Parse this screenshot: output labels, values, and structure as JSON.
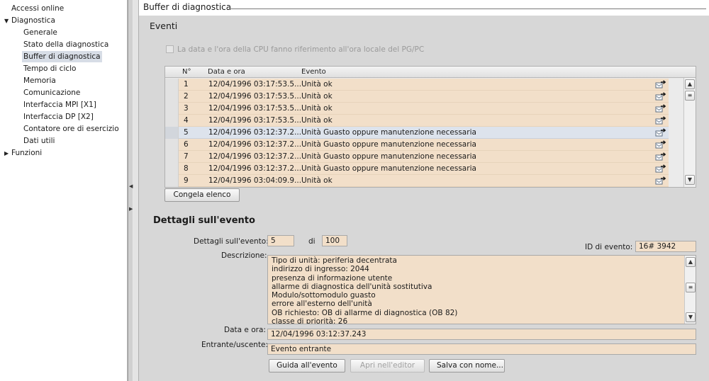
{
  "nav": {
    "items": [
      {
        "label": "Accessi online",
        "level": 0,
        "arrow": ""
      },
      {
        "label": "Diagnostica",
        "level": 0,
        "arrow": "▼"
      },
      {
        "label": "Generale",
        "level": 1,
        "arrow": ""
      },
      {
        "label": "Stato della diagnostica",
        "level": 1,
        "arrow": ""
      },
      {
        "label": "Buffer di diagnostica",
        "level": 1,
        "arrow": "",
        "selected": true
      },
      {
        "label": "Tempo di ciclo",
        "level": 1,
        "arrow": ""
      },
      {
        "label": "Memoria",
        "level": 1,
        "arrow": ""
      },
      {
        "label": "Comunicazione",
        "level": 1,
        "arrow": ""
      },
      {
        "label": "Interfaccia MPI [X1]",
        "level": 1,
        "arrow": ""
      },
      {
        "label": "Interfaccia DP [X2]",
        "level": 1,
        "arrow": ""
      },
      {
        "label": "Contatore ore di esercizio",
        "level": 1,
        "arrow": ""
      },
      {
        "label": "Dati utili",
        "level": 1,
        "arrow": ""
      },
      {
        "label": "Funzioni",
        "level": 0,
        "arrow": "▶"
      }
    ]
  },
  "header": {
    "title": "Buffer di diagnostica"
  },
  "events": {
    "section_title": "Eventi",
    "checkbox_label": "La data e l'ora della CPU fanno riferimento all'ora locale del PG/PC",
    "columns": [
      "N°",
      "Data e ora",
      "Evento"
    ],
    "rows": [
      {
        "n": "1",
        "datetime": "12/04/1996 03:17:53.5...",
        "event": "Unità ok"
      },
      {
        "n": "2",
        "datetime": "12/04/1996 03:17:53.5...",
        "event": "Unità ok"
      },
      {
        "n": "3",
        "datetime": "12/04/1996 03:17:53.5...",
        "event": "Unità ok"
      },
      {
        "n": "4",
        "datetime": "12/04/1996 03:17:53.5...",
        "event": "Unità ok"
      },
      {
        "n": "5",
        "datetime": "12/04/1996 03:12:37.2...",
        "event": "Unità Guasto oppure manutenzione necessaria",
        "selected": true
      },
      {
        "n": "6",
        "datetime": "12/04/1996 03:12:37.2...",
        "event": "Unità Guasto oppure manutenzione necessaria"
      },
      {
        "n": "7",
        "datetime": "12/04/1996 03:12:37.2...",
        "event": "Unità Guasto oppure manutenzione necessaria"
      },
      {
        "n": "8",
        "datetime": "12/04/1996 03:12:37.2...",
        "event": "Unità Guasto oppure manutenzione necessaria"
      },
      {
        "n": "9",
        "datetime": "12/04/1996 03:04:09.9...",
        "event": "Unità ok"
      }
    ],
    "freeze_button": "Congela elenco"
  },
  "details": {
    "section_title": "Dettagli sull'evento",
    "event_label": "Dettagli sull'evento:",
    "event_value": "5",
    "of_label": "di",
    "total_value": "100",
    "event_id_label": "ID di evento:",
    "event_id_value": "16# 3942",
    "description_label": "Descrizione:",
    "description_lines": [
      "Tipo di unità: periferia decentrata",
      "indirizzo di ingresso:  2044",
      "presenza di informazione utente",
      "allarme di diagnostica dell'unità sostitutiva",
      "Modulo/sottomodulo guasto",
      "errore all'esterno dell'unità",
      "OB richiesto: OB di allarme di diagnostica (OB 82)",
      "classe di priorità: 26"
    ],
    "datetime_label": "Data e ora:",
    "datetime_value": "12/04/1996 03:12:37.243",
    "inout_label": "Entrante/uscente:",
    "inout_value": "Evento entrante",
    "buttons": {
      "help": "Guida all'evento",
      "open_editor": "Apri nell'editor",
      "save_as": "Salva con nome..."
    }
  },
  "colors": {
    "row_bg": "#f2dfc9",
    "row_selected_bg": "#dde3ec",
    "panel_bg": "#d7d7d7",
    "nav_selected_bg": "#d7dde6"
  }
}
